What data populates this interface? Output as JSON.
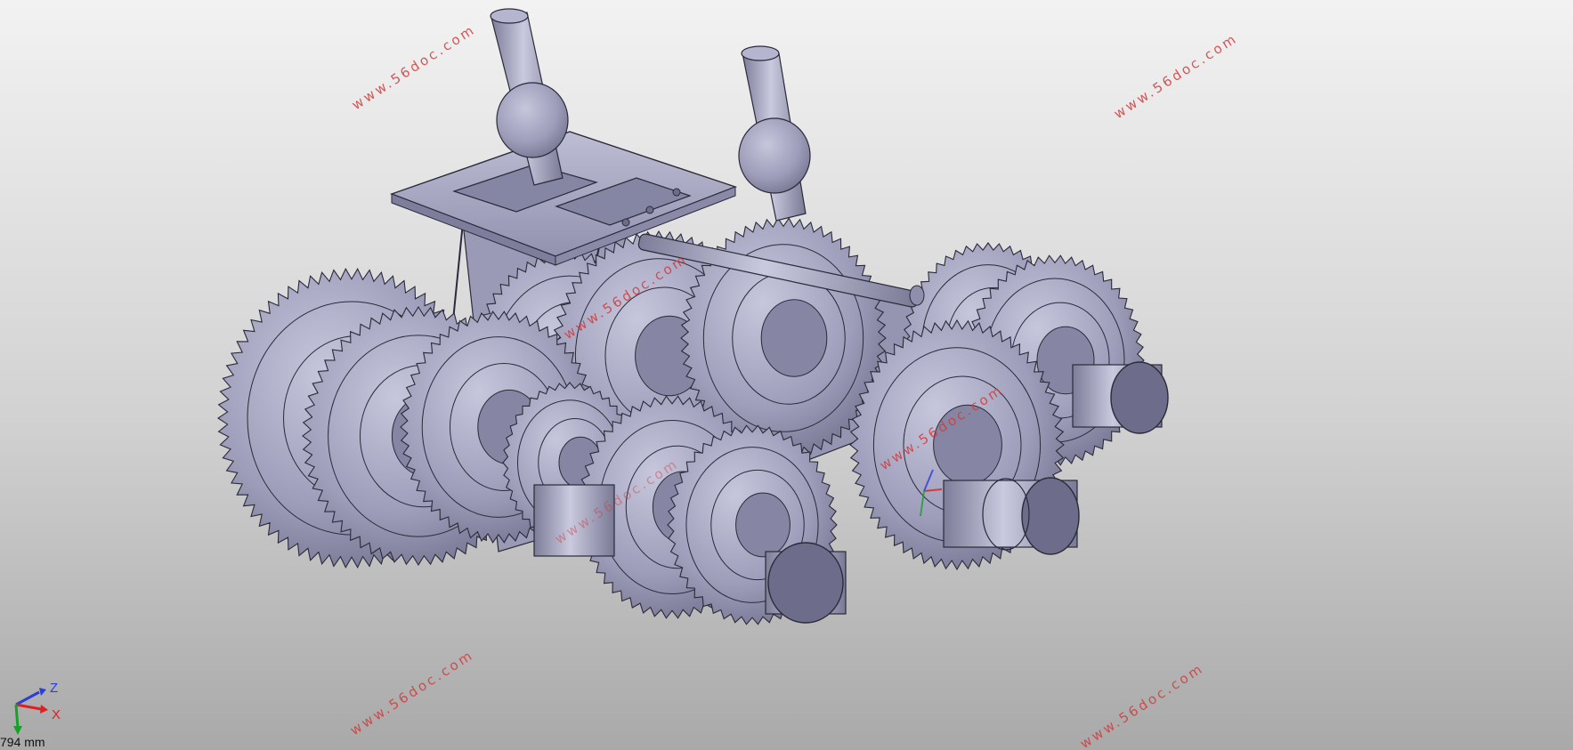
{
  "viewport": {
    "background_top": "#f2f2f2",
    "background_bottom": "#a9a9a9",
    "model_color": "#a7a7c2",
    "edge_color": "#2a2a3a"
  },
  "watermarks": [
    "www.56doc.com",
    "www.56doc.com",
    "www.56doc.com",
    "www.56doc.com",
    "www.56doc.com",
    "www.56doc.com",
    "www.56doc.com"
  ],
  "watermark_color": "#d23a3a",
  "triad": {
    "z_label": "Z",
    "x_label": "X",
    "z_color": "#2b3fd8",
    "x_color": "#e02020",
    "y_color": "#1aa02a"
  },
  "scale": {
    "label": "794 mm"
  }
}
